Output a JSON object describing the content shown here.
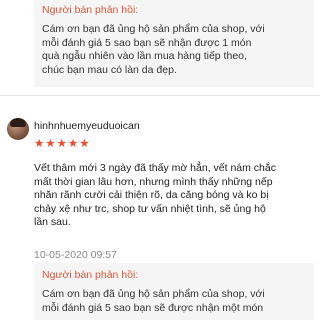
{
  "reply_top": {
    "title": "Người bán phản hồi:",
    "lines": [
      "Cám ơn bạn đã ủng hộ sản phẩm của shop, với",
      "mỗi đánh giá 5 sao bạn sẽ nhận được 1 món",
      "quà ngẫu nhiên vào lần mua hàng tiếp theo,",
      "chúc bạn mau có làn da đẹp."
    ]
  },
  "review": {
    "username": "hinhnhuemyeuduoican",
    "stars": "★★★★★",
    "rating": 5,
    "lines": [
      "Vết thâm mới 3 ngày đã thấy mờ hẳn, vết nám chắc",
      "mất thời gian lâu hơn, nhưng mình thấy những nếp",
      "nhăn rãnh cười cải thiện rõ, da căng bóng và ko bị",
      "chảy xệ như trc, shop tư vấn nhiệt tình, sẽ ủng hộ",
      "lần sau."
    ],
    "date": "10-05-2020 09:57"
  },
  "reply_bottom": {
    "title": "Người bán phản hồi:",
    "lines": [
      "Cám ơn bạn đã ủng hộ sản phẩm của shop, với",
      "mỗi đánh giá 5 sao bạn sẽ được nhận một món"
    ]
  },
  "colors": {
    "accent": "#ee4d2d",
    "reply_title": "#e0563a",
    "reply_bg": "#f5f5f5"
  }
}
